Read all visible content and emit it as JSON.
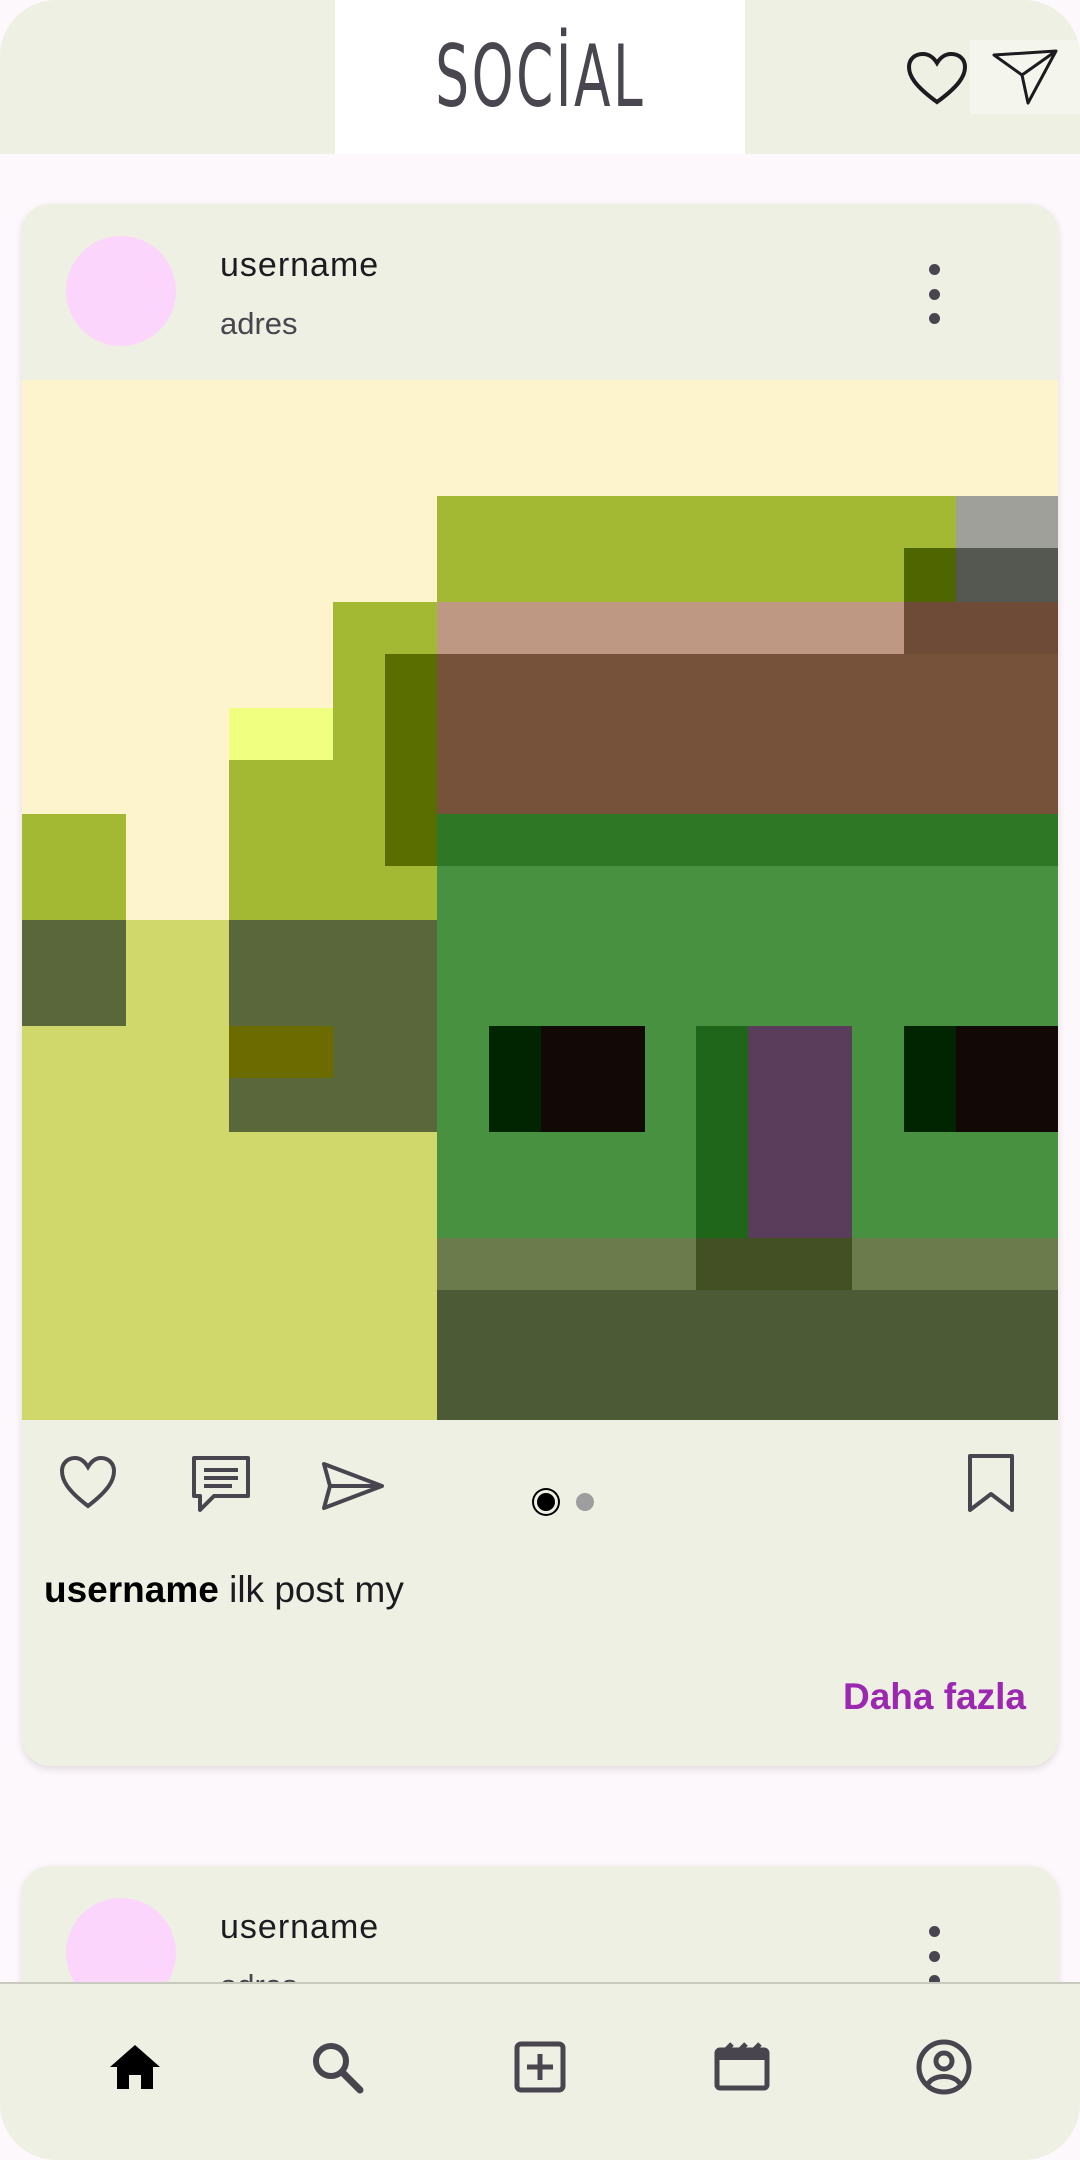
{
  "header": {
    "logo": "SOCİAL",
    "icons": [
      "heart-outline-icon",
      "send-paper-plane-icon"
    ]
  },
  "posts": [
    {
      "username": "username",
      "address": "adres",
      "caption_user": "username",
      "caption_text": " ilk post my",
      "more_label": "Daha fazla",
      "carousel": {
        "total": 2,
        "active": 1
      }
    },
    {
      "username": "username",
      "address": "adres"
    }
  ],
  "bottom_nav": {
    "items": [
      "home-icon",
      "search-icon",
      "add-box-icon",
      "movie-icon",
      "account-circle-icon"
    ],
    "active": "home-icon"
  },
  "colors": {
    "accent": "#9c27b0",
    "surface": "#eef0e3",
    "avatar": "#fcd5fc"
  }
}
